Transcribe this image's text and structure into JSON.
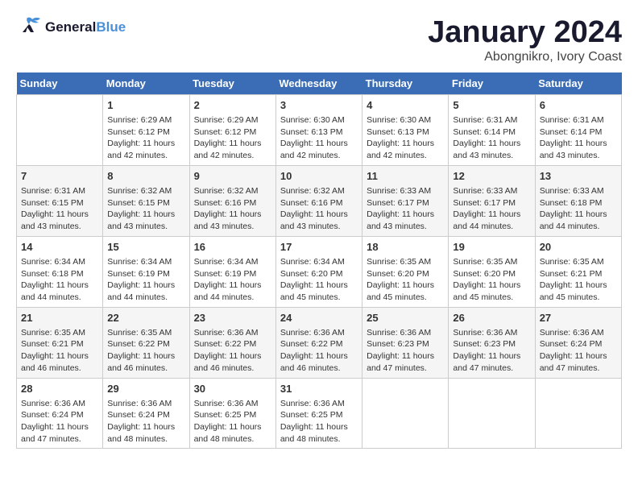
{
  "header": {
    "logo_line1": "General",
    "logo_line2": "Blue",
    "month": "January 2024",
    "location": "Abongnikro, Ivory Coast"
  },
  "days_of_week": [
    "Sunday",
    "Monday",
    "Tuesday",
    "Wednesday",
    "Thursday",
    "Friday",
    "Saturday"
  ],
  "weeks": [
    [
      {
        "day": "",
        "info": ""
      },
      {
        "day": "1",
        "info": "Sunrise: 6:29 AM\nSunset: 6:12 PM\nDaylight: 11 hours\nand 42 minutes."
      },
      {
        "day": "2",
        "info": "Sunrise: 6:29 AM\nSunset: 6:12 PM\nDaylight: 11 hours\nand 42 minutes."
      },
      {
        "day": "3",
        "info": "Sunrise: 6:30 AM\nSunset: 6:13 PM\nDaylight: 11 hours\nand 42 minutes."
      },
      {
        "day": "4",
        "info": "Sunrise: 6:30 AM\nSunset: 6:13 PM\nDaylight: 11 hours\nand 42 minutes."
      },
      {
        "day": "5",
        "info": "Sunrise: 6:31 AM\nSunset: 6:14 PM\nDaylight: 11 hours\nand 43 minutes."
      },
      {
        "day": "6",
        "info": "Sunrise: 6:31 AM\nSunset: 6:14 PM\nDaylight: 11 hours\nand 43 minutes."
      }
    ],
    [
      {
        "day": "7",
        "info": "Sunrise: 6:31 AM\nSunset: 6:15 PM\nDaylight: 11 hours\nand 43 minutes."
      },
      {
        "day": "8",
        "info": "Sunrise: 6:32 AM\nSunset: 6:15 PM\nDaylight: 11 hours\nand 43 minutes."
      },
      {
        "day": "9",
        "info": "Sunrise: 6:32 AM\nSunset: 6:16 PM\nDaylight: 11 hours\nand 43 minutes."
      },
      {
        "day": "10",
        "info": "Sunrise: 6:32 AM\nSunset: 6:16 PM\nDaylight: 11 hours\nand 43 minutes."
      },
      {
        "day": "11",
        "info": "Sunrise: 6:33 AM\nSunset: 6:17 PM\nDaylight: 11 hours\nand 43 minutes."
      },
      {
        "day": "12",
        "info": "Sunrise: 6:33 AM\nSunset: 6:17 PM\nDaylight: 11 hours\nand 44 minutes."
      },
      {
        "day": "13",
        "info": "Sunrise: 6:33 AM\nSunset: 6:18 PM\nDaylight: 11 hours\nand 44 minutes."
      }
    ],
    [
      {
        "day": "14",
        "info": "Sunrise: 6:34 AM\nSunset: 6:18 PM\nDaylight: 11 hours\nand 44 minutes."
      },
      {
        "day": "15",
        "info": "Sunrise: 6:34 AM\nSunset: 6:19 PM\nDaylight: 11 hours\nand 44 minutes."
      },
      {
        "day": "16",
        "info": "Sunrise: 6:34 AM\nSunset: 6:19 PM\nDaylight: 11 hours\nand 44 minutes."
      },
      {
        "day": "17",
        "info": "Sunrise: 6:34 AM\nSunset: 6:20 PM\nDaylight: 11 hours\nand 45 minutes."
      },
      {
        "day": "18",
        "info": "Sunrise: 6:35 AM\nSunset: 6:20 PM\nDaylight: 11 hours\nand 45 minutes."
      },
      {
        "day": "19",
        "info": "Sunrise: 6:35 AM\nSunset: 6:20 PM\nDaylight: 11 hours\nand 45 minutes."
      },
      {
        "day": "20",
        "info": "Sunrise: 6:35 AM\nSunset: 6:21 PM\nDaylight: 11 hours\nand 45 minutes."
      }
    ],
    [
      {
        "day": "21",
        "info": "Sunrise: 6:35 AM\nSunset: 6:21 PM\nDaylight: 11 hours\nand 46 minutes."
      },
      {
        "day": "22",
        "info": "Sunrise: 6:35 AM\nSunset: 6:22 PM\nDaylight: 11 hours\nand 46 minutes."
      },
      {
        "day": "23",
        "info": "Sunrise: 6:36 AM\nSunset: 6:22 PM\nDaylight: 11 hours\nand 46 minutes."
      },
      {
        "day": "24",
        "info": "Sunrise: 6:36 AM\nSunset: 6:22 PM\nDaylight: 11 hours\nand 46 minutes."
      },
      {
        "day": "25",
        "info": "Sunrise: 6:36 AM\nSunset: 6:23 PM\nDaylight: 11 hours\nand 47 minutes."
      },
      {
        "day": "26",
        "info": "Sunrise: 6:36 AM\nSunset: 6:23 PM\nDaylight: 11 hours\nand 47 minutes."
      },
      {
        "day": "27",
        "info": "Sunrise: 6:36 AM\nSunset: 6:24 PM\nDaylight: 11 hours\nand 47 minutes."
      }
    ],
    [
      {
        "day": "28",
        "info": "Sunrise: 6:36 AM\nSunset: 6:24 PM\nDaylight: 11 hours\nand 47 minutes."
      },
      {
        "day": "29",
        "info": "Sunrise: 6:36 AM\nSunset: 6:24 PM\nDaylight: 11 hours\nand 48 minutes."
      },
      {
        "day": "30",
        "info": "Sunrise: 6:36 AM\nSunset: 6:25 PM\nDaylight: 11 hours\nand 48 minutes."
      },
      {
        "day": "31",
        "info": "Sunrise: 6:36 AM\nSunset: 6:25 PM\nDaylight: 11 hours\nand 48 minutes."
      },
      {
        "day": "",
        "info": ""
      },
      {
        "day": "",
        "info": ""
      },
      {
        "day": "",
        "info": ""
      }
    ]
  ]
}
